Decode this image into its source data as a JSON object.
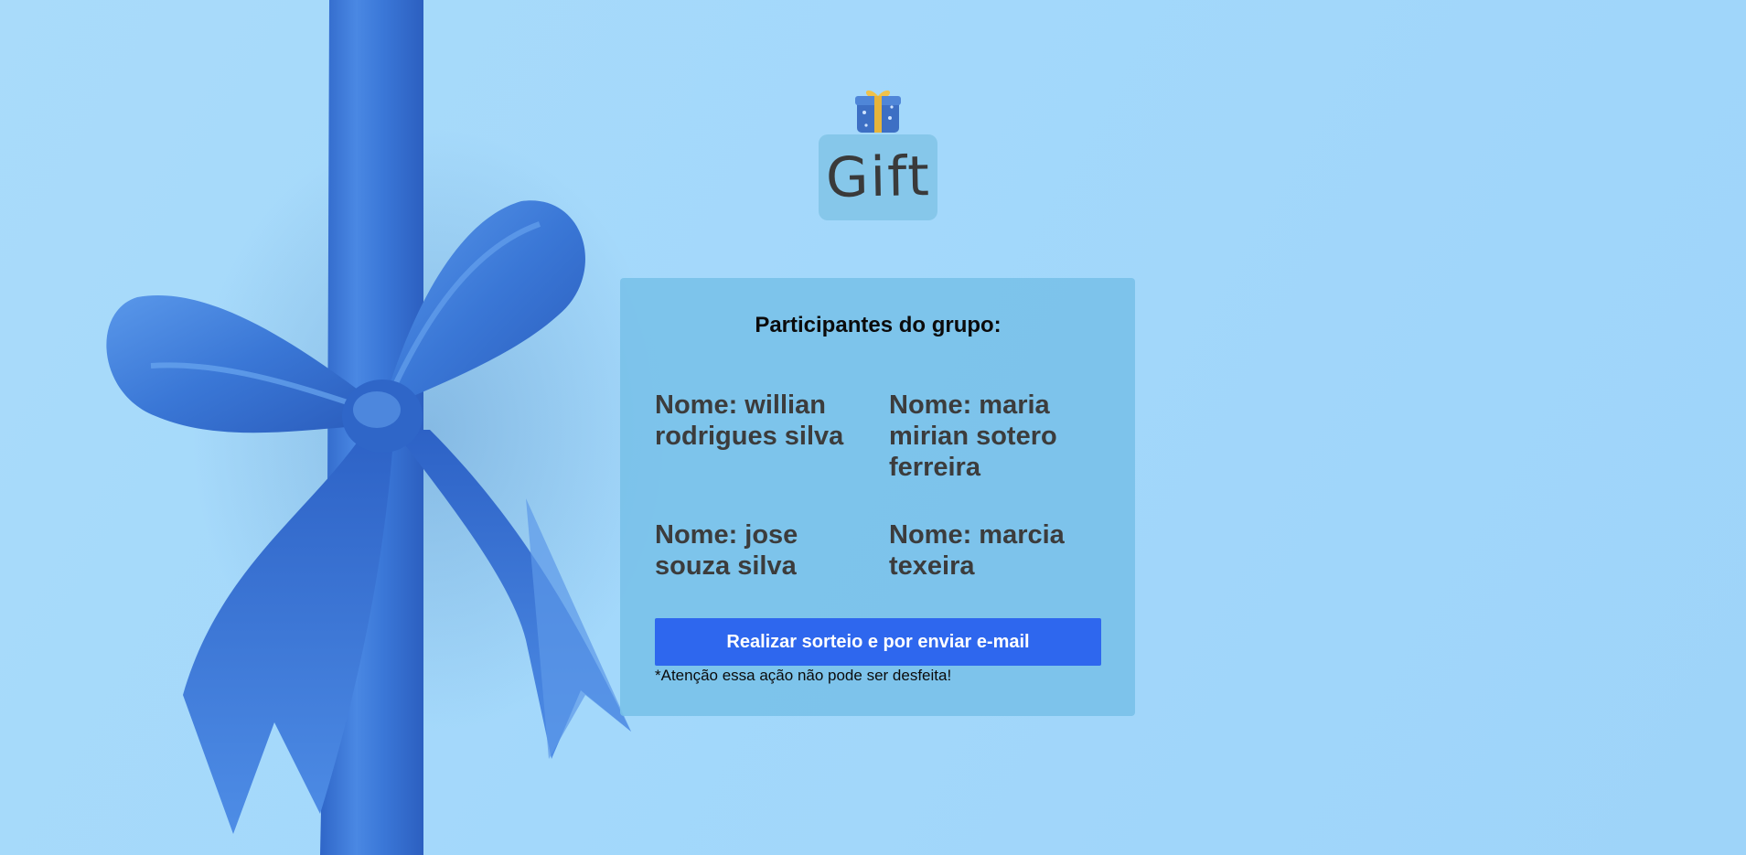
{
  "logo": {
    "icon": "gift-box-icon",
    "text": "Gift"
  },
  "group": {
    "title": "Participantes do grupo:",
    "participants": [
      "Nome: willian rodrigues silva",
      "Nome: maria mirian sotero ferreira",
      "Nome: jose souza silva",
      "Nome: marcia texeira"
    ],
    "draw_button_label": "Realizar sorteio e por enviar e-mail",
    "warning": "*Atenção essa ação não pode ser desfeita!"
  },
  "colors": {
    "background": "#a3d8fb",
    "card": "#7fc4ea",
    "button": "#2e67ee",
    "ribbon": "#3a77d6"
  }
}
